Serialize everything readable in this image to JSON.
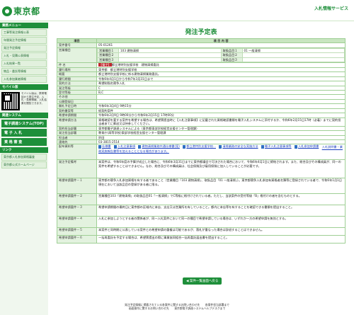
{
  "header": {
    "logo": "東京都",
    "service": "入札情報サービス"
  },
  "side": {
    "menu_title": "業務メニュー",
    "menu_items": [
      "工事等発注情報公表",
      "年間発注予定情報",
      "発注予定情報",
      "入札・見積公表情報",
      "入札結果一覧",
      "物品・委託等情報",
      "入札参加業者情報"
    ],
    "mobile_title": "モバイル版",
    "mobile_text": "モバイル版は、携帯電話から発注予定、入札・見積情報、入札結果を閲覧できます。",
    "sys_title": "関連システム",
    "sys_items": [
      "電子調達システム(TOP)",
      "電 子 入 札",
      "資 格 審 査"
    ],
    "link_title": "リンク",
    "links": [
      "東京都入札参加資格審査",
      "東京都公式ホームページ"
    ]
  },
  "page": {
    "title": "発注予定表",
    "col_item": "項目",
    "col_content": "項 目 内 容",
    "back": "案件一覧画面へ戻る"
  },
  "rows": {
    "case_no": {
      "k": "案件番号",
      "v": "05-01261"
    },
    "biz_k": "営業種目",
    "biz": [
      [
        "営業種目１",
        "103 建物清掃",
        "取扱品目１",
        "01 一般清掃"
      ],
      [
        "営業種目２",
        "",
        "取扱品目２",
        ""
      ],
      [
        "営業種目３",
        "",
        "取扱品目３",
        ""
      ]
    ],
    "name": {
      "k": "件 名",
      "tag": "【電子】",
      "v": "都立港特別支援学校　建物清掃委託"
    },
    "place": {
      "k": "履行場所",
      "v": "東京都　都立港特別支援学校"
    },
    "summary": {
      "k": "概要",
      "v": "都立港特別支援学校に係る建物清掃業務委託。"
    },
    "period": {
      "k": "履行期間",
      "v": "令和6年4月1日から令和7年3月31日まで"
    },
    "method": {
      "k": "契約方法",
      "v": "希望制指名競争入札"
    },
    "grade": {
      "k": "発注等級",
      "v": "C"
    },
    "accept": {
      "k": "受付等級",
      "v": "B,C"
    },
    "other": {
      "k": "その他",
      "v": ""
    },
    "pubdate": {
      "k": "公開登録日",
      "v": ""
    },
    "open": {
      "k": "開札予定日時",
      "v": "令和6年3月4日 9時15分"
    },
    "contract": {
      "k": "契約書案等",
      "v": "紙契約案件"
    },
    "apply": {
      "k": "希望申請期間",
      "v": "令和6年2月9日 9時00分から令和6年2月15日 17時00分"
    },
    "applym": {
      "k": "希望申請方法",
      "v": "資格確認を要する案件を希望する場合は、希望票提出時に【入札注意事項】に記載された資格確認書類を電子入札システムに添付するか、令和6年2月15日17時（必着）までに契約担当者あてに郵送又は持参してください。"
    },
    "dept": {
      "k": "契約担当部署",
      "v": "東京都電子調達システムによる（東京都東部学校経営支援センター管理課）"
    },
    "incharge": {
      "k": "発注担当部署",
      "v": "教育庁(高等学校)東部学校経営支援センター管理課"
    },
    "person": {
      "k": "担当者",
      "v": "鈴田"
    },
    "tel": {
      "k": "連絡先",
      "v": "03-3815-2514"
    },
    "files": {
      "k": "配布資料等",
      "items": [
        "仕様書",
        "入札注意事項",
        "建物清掃業務共通仕様書(案)",
        "都立港特別支援学校...",
        "清掃業務の安全な実施方法",
        "電子入札注意事項等",
        "入札参加申請書"
      ],
      "extra": "入札説明書・業務実施報告書等を加えることとなる場合があります。"
    },
    "notes": {
      "k": "発注予定備考",
      "v": "本案件は、令和6年度の予算が成立した場合に、令和6年3月31日までに東京都議会で可決された場合において、令和6年4月1日に締結されます。また、総合及びその構成員が、同一の案件を希望することはできません。なお、総合及びその構成員は、社会保険及び雇用保険に加入していることが必要です。"
    },
    "req1": {
      "k": "希望申請要件－１",
      "v": "東京都の競争入札参加資格を有する者であること（営業種目「103 建物清掃」、取扱品目「01 一般清掃」）。東京都競争入札参加有資格者名簿等に登録されている者で、令和6年1月1日現在において当該品目の登録がある者に限る。"
    },
    "req2": {
      "k": "希望申請要件－２",
      "v": "営業種目103「建物清掃」の取扱品目01「一般清掃」でC等級に格付けされている者。ただし、当該案件の受付等級「B」格付けの者を含むものとする。"
    },
    "req3": {
      "k": "希望申請要件－３",
      "v": "希望申請期間の最終日に東京都の区域内に本店、支店又は営業所を有していること。都内に本店等を有することを確認できる書類を提出すること。"
    },
    "req4": {
      "k": "希望申請要件－４",
      "v": "入札に参加しようとする者の関係者が、同一入札案件において同一の種目で希望申請している場合は、いずれか一方の希望申請を無効とする。"
    },
    "req5": {
      "k": "希望申請要件－５",
      "v": "本案件と同時期に公表している案件との希望申請の重複は可能であるが、落札が重なった場合は辞退することはできません。"
    },
    "req6": {
      "k": "希望申請要件－６",
      "v": "一括再委託を予定する場合は、希望票提出の際に事業協同組合一括再委託届出書を提出すること。"
    }
  },
  "footer": {
    "line1": "発注予定情報に掲載されている各案件に関するお問い合わせ先　　各案件担当部署まで",
    "line2": "画面操作に関するお問い合わせ先　　東京都電子調達システムヘルプデスクまで"
  },
  "colors": {
    "brand": "#1e8f3a",
    "tag": "#c0272d"
  }
}
